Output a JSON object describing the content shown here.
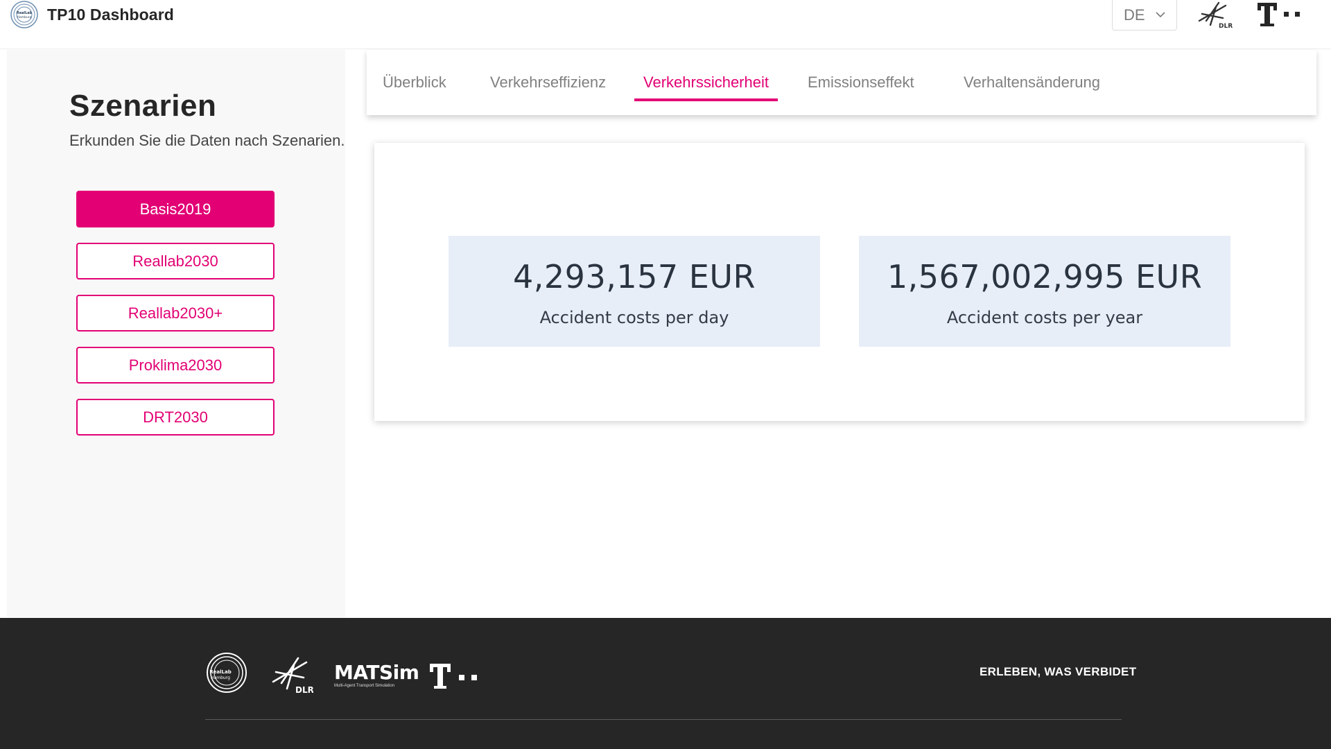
{
  "header": {
    "title": "TP10 Dashboard",
    "language": "DE",
    "logos": [
      "realab-hamburg-logo",
      "dlr-logo",
      "telekom-logo"
    ]
  },
  "sidebar": {
    "title": "Szenarien",
    "subtitle": "Erkunden Sie die Daten nach Szenarien.",
    "scenarios": [
      {
        "label": "Basis2019",
        "active": true
      },
      {
        "label": "Reallab2030",
        "active": false
      },
      {
        "label": "Reallab2030+",
        "active": false
      },
      {
        "label": "Proklima2030",
        "active": false
      },
      {
        "label": "DRT2030",
        "active": false
      }
    ]
  },
  "tabs": [
    {
      "label": "Überblick",
      "active": false
    },
    {
      "label": "Verkehrseffizienz",
      "active": false
    },
    {
      "label": "Verkehrssicherheit",
      "active": true
    },
    {
      "label": "Emissionseffekt",
      "active": false
    },
    {
      "label": "Verhaltensänderung",
      "active": false
    }
  ],
  "kpis": [
    {
      "value": "4,293,157 EUR",
      "label": "Accident costs per day"
    },
    {
      "value": "1,567,002,995 EUR",
      "label": "Accident costs per year"
    }
  ],
  "footer": {
    "slogan": "ERLEBEN, WAS VERBIDET",
    "matsim_text": "MATSim",
    "matsim_sub": "Multi-Agent Transport Simulation"
  },
  "colors": {
    "accent": "#e20074",
    "kpi_bg": "#e7eef8",
    "footer_bg": "#262626"
  }
}
